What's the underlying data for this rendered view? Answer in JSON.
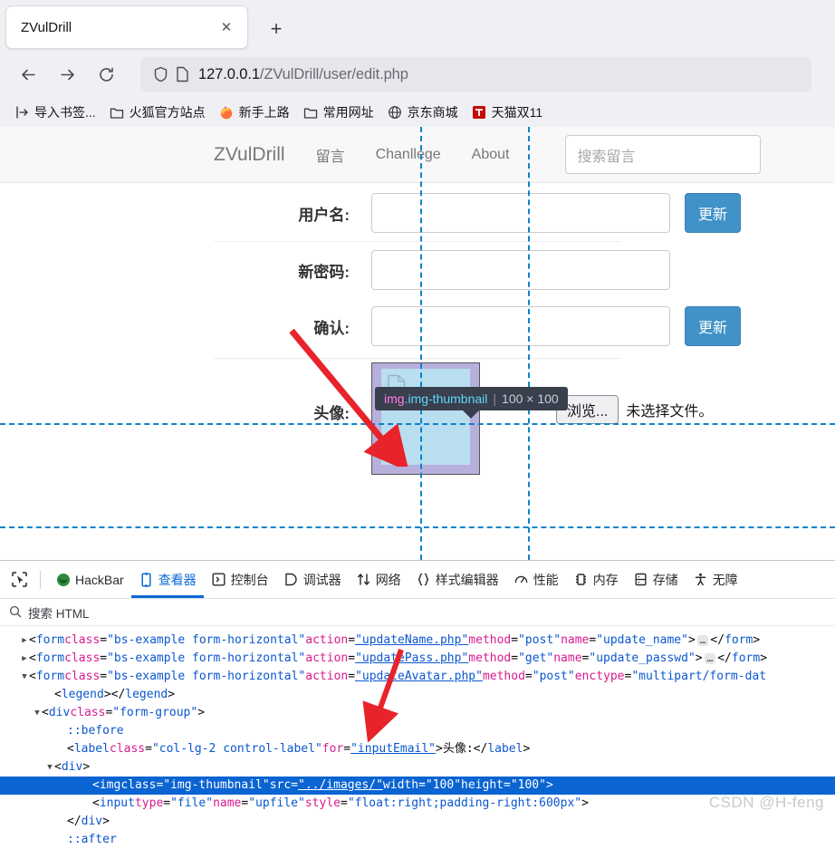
{
  "browser": {
    "tab": {
      "title": "ZVulDrill",
      "close_label": "✕"
    },
    "new_tab_label": "+",
    "url": {
      "host": "127.0.0.1",
      "path": "/ZVulDrill/user/edit.php"
    },
    "bookmarks": [
      {
        "label": "导入书签...",
        "icon": "import-icon"
      },
      {
        "label": "火狐官方站点",
        "icon": "folder-icon"
      },
      {
        "label": "新手上路",
        "icon": "firefox-icon"
      },
      {
        "label": "常用网址",
        "icon": "folder-icon"
      },
      {
        "label": "京东商城",
        "icon": "globe-icon"
      },
      {
        "label": "天猫双11",
        "icon": "tmall-icon"
      }
    ]
  },
  "page": {
    "navbar": {
      "brand": "ZVulDrill",
      "links": [
        "留言",
        "Chanllege",
        "About"
      ],
      "search_placeholder": "搜索留言",
      "search_value": ""
    },
    "form": {
      "rows": [
        {
          "label": "用户名:",
          "value": "",
          "button": "更新",
          "has_button": true
        },
        {
          "label": "新密码:",
          "value": "",
          "button": "",
          "has_button": false
        },
        {
          "label": "确认:",
          "value": "",
          "button": "更新",
          "has_button": true
        }
      ],
      "avatar": {
        "label": "头像:",
        "browse_label": "浏览...",
        "file_status": "未选择文件。"
      }
    }
  },
  "inspector_tooltip": {
    "element": "img",
    "class": ".img-thumbnail",
    "dimensions": "100 × 100"
  },
  "devtools": {
    "picker_icon": "element-picker-icon",
    "tabs": [
      {
        "label": "HackBar",
        "icon": "hackbar-icon",
        "active": false
      },
      {
        "label": "查看器",
        "icon": "inspector-icon",
        "active": true
      },
      {
        "label": "控制台",
        "icon": "console-icon",
        "active": false
      },
      {
        "label": "调试器",
        "icon": "debugger-icon",
        "active": false
      },
      {
        "label": "网络",
        "icon": "network-icon",
        "active": false
      },
      {
        "label": "样式编辑器",
        "icon": "style-editor-icon",
        "active": false
      },
      {
        "label": "性能",
        "icon": "performance-icon",
        "active": false
      },
      {
        "label": "内存",
        "icon": "memory-icon",
        "active": false
      },
      {
        "label": "存储",
        "icon": "storage-icon",
        "active": false
      },
      {
        "label": "无障",
        "icon": "accessibility-icon",
        "active": false
      }
    ],
    "search_placeholder": "搜索 HTML",
    "markup_lines": [
      {
        "twisty": "collapsed",
        "indent": 1,
        "selected": false,
        "parts": [
          {
            "t": "pun",
            "v": "<"
          },
          {
            "t": "tag",
            "v": "form"
          },
          {
            "t": "pun",
            "v": " "
          },
          {
            "t": "attr",
            "v": "class"
          },
          {
            "t": "pun",
            "v": "="
          },
          {
            "t": "val",
            "v": "\"bs-example form-horizontal\""
          },
          {
            "t": "pun",
            "v": " "
          },
          {
            "t": "attr",
            "v": "action"
          },
          {
            "t": "pun",
            "v": "="
          },
          {
            "t": "val u",
            "v": "\"updateName.php\""
          },
          {
            "t": "pun",
            "v": " "
          },
          {
            "t": "attr",
            "v": "method"
          },
          {
            "t": "pun",
            "v": "="
          },
          {
            "t": "val",
            "v": "\"post\""
          },
          {
            "t": "pun",
            "v": " "
          },
          {
            "t": "attr",
            "v": "name"
          },
          {
            "t": "pun",
            "v": "="
          },
          {
            "t": "val",
            "v": "\"update_name\""
          },
          {
            "t": "pun",
            "v": ">"
          },
          {
            "t": "ellip",
            "v": "…"
          },
          {
            "t": "pun",
            "v": "</"
          },
          {
            "t": "tag",
            "v": "form"
          },
          {
            "t": "pun",
            "v": ">"
          }
        ]
      },
      {
        "twisty": "collapsed",
        "indent": 1,
        "selected": false,
        "parts": [
          {
            "t": "pun",
            "v": "<"
          },
          {
            "t": "tag",
            "v": "form"
          },
          {
            "t": "pun",
            "v": " "
          },
          {
            "t": "attr",
            "v": "class"
          },
          {
            "t": "pun",
            "v": "="
          },
          {
            "t": "val",
            "v": "\"bs-example form-horizontal\""
          },
          {
            "t": "pun",
            "v": " "
          },
          {
            "t": "attr",
            "v": "action"
          },
          {
            "t": "pun",
            "v": "="
          },
          {
            "t": "val u",
            "v": "\"updatePass.php\""
          },
          {
            "t": "pun",
            "v": " "
          },
          {
            "t": "attr",
            "v": "method"
          },
          {
            "t": "pun",
            "v": "="
          },
          {
            "t": "val",
            "v": "\"get\""
          },
          {
            "t": "pun",
            "v": " "
          },
          {
            "t": "attr",
            "v": "name"
          },
          {
            "t": "pun",
            "v": "="
          },
          {
            "t": "val",
            "v": "\"update_passwd\""
          },
          {
            "t": "pun",
            "v": ">"
          },
          {
            "t": "ellip",
            "v": "…"
          },
          {
            "t": "pun",
            "v": "</"
          },
          {
            "t": "tag",
            "v": "form"
          },
          {
            "t": "pun",
            "v": ">"
          }
        ]
      },
      {
        "twisty": "expanded",
        "indent": 1,
        "selected": false,
        "parts": [
          {
            "t": "pun",
            "v": "<"
          },
          {
            "t": "tag",
            "v": "form"
          },
          {
            "t": "pun",
            "v": " "
          },
          {
            "t": "attr",
            "v": "class"
          },
          {
            "t": "pun",
            "v": "="
          },
          {
            "t": "val",
            "v": "\"bs-example form-horizontal\""
          },
          {
            "t": "pun",
            "v": " "
          },
          {
            "t": "attr",
            "v": "action"
          },
          {
            "t": "pun",
            "v": "="
          },
          {
            "t": "val u",
            "v": "\"updateAvatar.php\""
          },
          {
            "t": "pun",
            "v": " "
          },
          {
            "t": "attr",
            "v": "method"
          },
          {
            "t": "pun",
            "v": "="
          },
          {
            "t": "val",
            "v": "\"post\""
          },
          {
            "t": "pun",
            "v": " "
          },
          {
            "t": "attr",
            "v": "enctype"
          },
          {
            "t": "pun",
            "v": "="
          },
          {
            "t": "val",
            "v": "\"multipart/form-dat"
          }
        ]
      },
      {
        "twisty": "none",
        "indent": 3,
        "selected": false,
        "parts": [
          {
            "t": "pun",
            "v": "<"
          },
          {
            "t": "tag",
            "v": "legend"
          },
          {
            "t": "pun",
            "v": "></"
          },
          {
            "t": "tag",
            "v": "legend"
          },
          {
            "t": "pun",
            "v": ">"
          }
        ]
      },
      {
        "twisty": "expanded",
        "indent": 2,
        "selected": false,
        "parts": [
          {
            "t": "pun",
            "v": "<"
          },
          {
            "t": "tag",
            "v": "div"
          },
          {
            "t": "pun",
            "v": " "
          },
          {
            "t": "attr",
            "v": "class"
          },
          {
            "t": "pun",
            "v": "="
          },
          {
            "t": "val",
            "v": "\"form-group\""
          },
          {
            "t": "pun",
            "v": ">"
          }
        ]
      },
      {
        "twisty": "none",
        "indent": 4,
        "selected": false,
        "parts": [
          {
            "t": "pseudo",
            "v": "::before"
          }
        ]
      },
      {
        "twisty": "none",
        "indent": 4,
        "selected": false,
        "parts": [
          {
            "t": "pun",
            "v": "<"
          },
          {
            "t": "tag",
            "v": "label"
          },
          {
            "t": "pun",
            "v": " "
          },
          {
            "t": "attr",
            "v": "class"
          },
          {
            "t": "pun",
            "v": "="
          },
          {
            "t": "val",
            "v": "\"col-lg-2 control-label\""
          },
          {
            "t": "pun",
            "v": " "
          },
          {
            "t": "attr",
            "v": "for"
          },
          {
            "t": "pun",
            "v": "="
          },
          {
            "t": "val u",
            "v": "\"inputEmail\""
          },
          {
            "t": "pun",
            "v": ">"
          },
          {
            "t": "txtnode",
            "v": "头像: "
          },
          {
            "t": "pun",
            "v": "</"
          },
          {
            "t": "tag",
            "v": "label"
          },
          {
            "t": "pun",
            "v": ">"
          }
        ]
      },
      {
        "twisty": "expanded",
        "indent": 3,
        "selected": false,
        "parts": [
          {
            "t": "pun",
            "v": "<"
          },
          {
            "t": "tag",
            "v": "div"
          },
          {
            "t": "pun",
            "v": ">"
          }
        ]
      },
      {
        "twisty": "none",
        "indent": 6,
        "selected": true,
        "parts": [
          {
            "t": "pun",
            "v": "<"
          },
          {
            "t": "tag",
            "v": "img"
          },
          {
            "t": "pun",
            "v": " "
          },
          {
            "t": "attr",
            "v": "class"
          },
          {
            "t": "pun",
            "v": "="
          },
          {
            "t": "val",
            "v": "\"img-thumbnail\""
          },
          {
            "t": "pun",
            "v": " "
          },
          {
            "t": "attr",
            "v": "src"
          },
          {
            "t": "pun",
            "v": "="
          },
          {
            "t": "val u",
            "v": "\"../images/\""
          },
          {
            "t": "pun",
            "v": " "
          },
          {
            "t": "attr",
            "v": "width"
          },
          {
            "t": "pun",
            "v": "="
          },
          {
            "t": "val",
            "v": "\"100\""
          },
          {
            "t": "pun",
            "v": " "
          },
          {
            "t": "attr",
            "v": "height"
          },
          {
            "t": "pun",
            "v": "="
          },
          {
            "t": "val",
            "v": "\"100\""
          },
          {
            "t": "pun",
            "v": ">"
          }
        ]
      },
      {
        "twisty": "none",
        "indent": 6,
        "selected": false,
        "parts": [
          {
            "t": "pun",
            "v": "<"
          },
          {
            "t": "tag",
            "v": "input"
          },
          {
            "t": "pun",
            "v": " "
          },
          {
            "t": "attr",
            "v": "type"
          },
          {
            "t": "pun",
            "v": "="
          },
          {
            "t": "val",
            "v": "\"file\""
          },
          {
            "t": "pun",
            "v": " "
          },
          {
            "t": "attr",
            "v": "name"
          },
          {
            "t": "pun",
            "v": "="
          },
          {
            "t": "val",
            "v": "\"upfile\""
          },
          {
            "t": "pun",
            "v": " "
          },
          {
            "t": "attr",
            "v": "style"
          },
          {
            "t": "pun",
            "v": "="
          },
          {
            "t": "val",
            "v": "\"float:right;padding-right:600px\""
          },
          {
            "t": "pun",
            "v": ">"
          }
        ]
      },
      {
        "twisty": "none",
        "indent": 4,
        "selected": false,
        "parts": [
          {
            "t": "pun",
            "v": "</"
          },
          {
            "t": "tag",
            "v": "div"
          },
          {
            "t": "pun",
            "v": ">"
          }
        ]
      },
      {
        "twisty": "none",
        "indent": 4,
        "selected": false,
        "parts": [
          {
            "t": "pseudo",
            "v": "::after"
          }
        ]
      }
    ],
    "watermark": "CSDN @H-feng"
  },
  "colors": {
    "accent_blue": "#0a69d6",
    "button_blue": "#4192c8",
    "guide_blue": "#0b84c9",
    "highlight_content": "#b9def0",
    "highlight_padding": "#b7b0dd",
    "arrow_red": "#e8232a",
    "selected_row": "#0a64d2"
  }
}
